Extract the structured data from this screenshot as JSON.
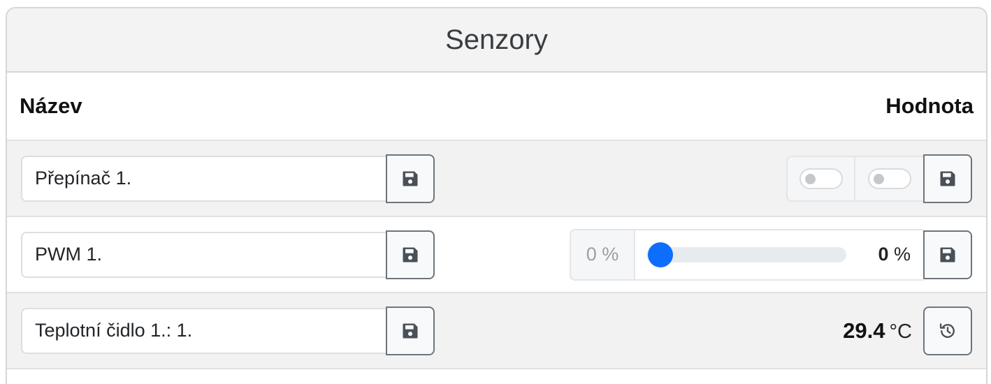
{
  "card": {
    "title": "Senzory"
  },
  "table": {
    "col_name": "Název",
    "col_value": "Hodnota"
  },
  "rows": [
    {
      "name": "Přepínač 1.",
      "type": "switch",
      "switches": [
        false,
        false
      ]
    },
    {
      "name": "PWM 1.",
      "type": "pwm",
      "min_label": "0 %",
      "value": "0",
      "unit": "%",
      "slider_fraction": 0
    },
    {
      "name": "Teplotní čidlo 1.: 1.",
      "type": "temperature",
      "value": "29.4",
      "unit": "°C"
    }
  ],
  "icons": {
    "save": "floppy-disk-icon",
    "history": "history-icon"
  },
  "colors": {
    "accent": "#0d6efd",
    "header_bg": "#f3f3f3",
    "stripe_bg": "#f2f2f2"
  }
}
